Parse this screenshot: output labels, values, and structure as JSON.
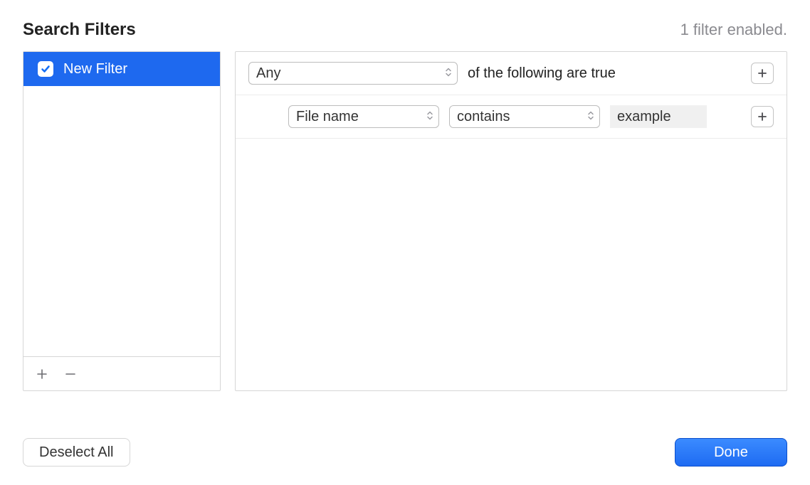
{
  "header": {
    "title": "Search Filters",
    "status": "1 filter enabled."
  },
  "sidebar": {
    "filters": [
      {
        "label": "New Filter",
        "checked": true,
        "selected": true
      }
    ]
  },
  "rules": {
    "group_match": "Any",
    "group_text": "of the following are true",
    "conditions": [
      {
        "attribute": "File name",
        "operator": "contains",
        "value": "example"
      }
    ]
  },
  "footer": {
    "deselect_label": "Deselect All",
    "done_label": "Done"
  }
}
